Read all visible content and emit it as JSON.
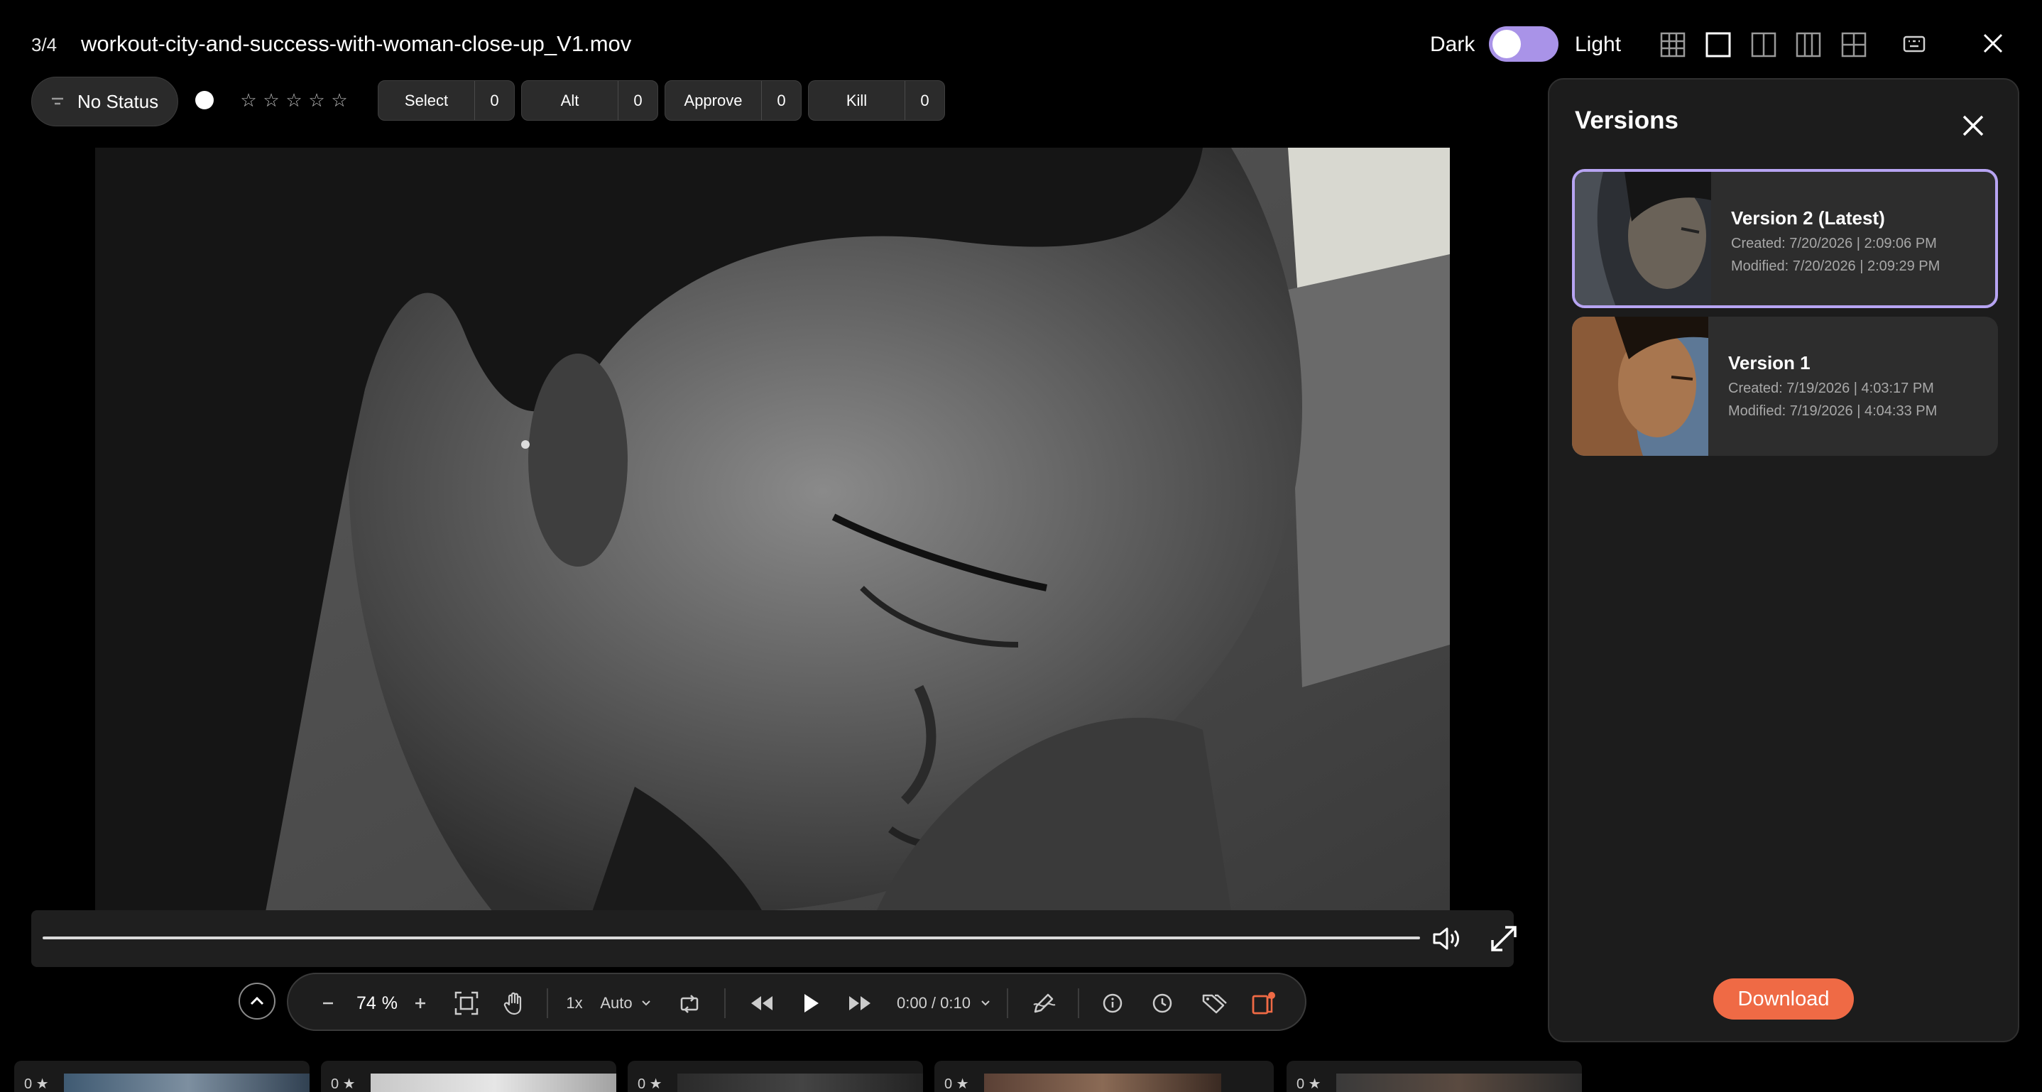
{
  "header": {
    "counter": "3/4",
    "filename": "workout-city-and-success-with-woman-close-up_V1.mov",
    "theme_dark_label": "Dark",
    "theme_light_label": "Light",
    "layout_icons": [
      "grid-9-icon",
      "single-view-icon",
      "split-2-icon",
      "split-3-icon",
      "grid-4-icon"
    ],
    "active_layout": "single-view-icon"
  },
  "status_bar": {
    "status_label": "No Status",
    "rating_stars": 5,
    "rating_value": 0,
    "tags": [
      {
        "label": "Select",
        "count": "0"
      },
      {
        "label": "Alt",
        "count": "0"
      },
      {
        "label": "Approve",
        "count": "0"
      },
      {
        "label": "Kill",
        "count": "0"
      }
    ]
  },
  "player": {
    "progress": 0,
    "zoom_value": "74",
    "zoom_unit": "%",
    "speed": "1x",
    "quality": "Auto",
    "timecode": "0:00 / 0:10"
  },
  "filmstrip": {
    "items": [
      {
        "count": "0"
      },
      {
        "count": "0"
      },
      {
        "count": "0"
      },
      {
        "count": "0"
      },
      {
        "count": "0"
      }
    ]
  },
  "versions_panel": {
    "title": "Versions",
    "versions": [
      {
        "name": "Version 2 (Latest)",
        "created": "Created: 7/20/2026 | 2:09:06 PM",
        "modified": "Modified: 7/20/2026 | 2:09:29 PM",
        "active": true
      },
      {
        "name": "Version 1",
        "created": "Created: 7/19/2026 | 4:03:17 PM",
        "modified": "Modified: 7/19/2026 | 4:04:33 PM",
        "active": false
      }
    ],
    "download_label": "Download"
  },
  "colors": {
    "accent": "#ef6a45",
    "toggle": "#a993e8",
    "active_version_border": "#b7a4f2"
  }
}
